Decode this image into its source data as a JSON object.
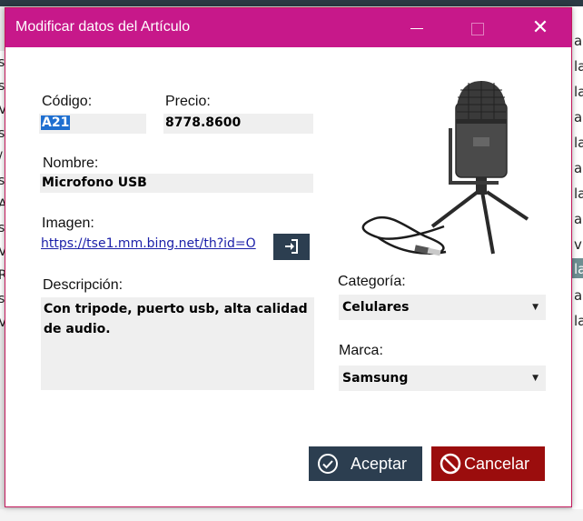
{
  "background": {
    "right_letters": [
      "a",
      "la",
      "la",
      "a",
      "la",
      "a",
      "la",
      "a",
      "vi",
      "la",
      "a",
      "la"
    ],
    "left_letters": [
      "s",
      "s",
      "V",
      "s",
      "/",
      "s",
      "A",
      "s",
      "V",
      "R",
      "s",
      "V"
    ]
  },
  "dialog": {
    "title": "Modificar datos del Artículo",
    "minimize_label": "",
    "close_label": "✕"
  },
  "form": {
    "codigo_label": "Código:",
    "codigo_value": "A21",
    "precio_label": "Precio:",
    "precio_value": "8778.8600",
    "nombre_label": "Nombre:",
    "nombre_value": "Microfono USB",
    "imagen_label": "Imagen:",
    "imagen_url": "https://tse1.mm.bing.net/th?id=O",
    "descripcion_label": "Descripción:",
    "descripcion_value": "Con tripode, puerto usb, alta calidad de audio.",
    "categoria_label": "Categoría:",
    "categoria_value": "Celulares",
    "marca_label": "Marca:",
    "marca_value": "Samsung"
  },
  "buttons": {
    "aceptar": "Aceptar",
    "cancelar": "Cancelar"
  },
  "colors": {
    "titlebar": "#c7188a",
    "accept": "#2c3e50",
    "cancel": "#9b0d0d"
  },
  "icons": {
    "load_image": "sign-in-icon",
    "accept": "check-circle-icon",
    "cancel": "ban-icon"
  }
}
